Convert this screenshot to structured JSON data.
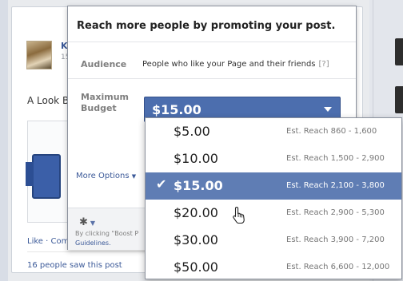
{
  "post": {
    "name": "Ke",
    "sub": "15",
    "text": "A Look B",
    "actions": "Like · Com",
    "saw": "16 people saw this post"
  },
  "boost": {
    "title": "Reach more people by promoting your post.",
    "audience_label": "Audience",
    "audience_value": "People who like your Page and their friends",
    "audience_help": "[?]",
    "budget_label": "Maximum Budget",
    "budget_selected": "$15.00",
    "more_options": "More Options",
    "footer_note": "By clicking \"Boost P",
    "footer_link": "Guidelines."
  },
  "dropdown": {
    "options": [
      {
        "price": "$5.00",
        "reach": "Est. Reach 860 - 1,600",
        "selected": false
      },
      {
        "price": "$10.00",
        "reach": "Est. Reach 1,500 - 2,900",
        "selected": false
      },
      {
        "price": "$15.00",
        "reach": "Est. Reach 2,100 - 3,800",
        "selected": true
      },
      {
        "price": "$20.00",
        "reach": "Est. Reach 2,900 - 5,300",
        "selected": false
      },
      {
        "price": "$30.00",
        "reach": "Est. Reach 3,900 - 7,200",
        "selected": false
      },
      {
        "price": "$50.00",
        "reach": "Est. Reach 6,600 - 12,000",
        "selected": false
      }
    ]
  },
  "colors": {
    "accent": "#4c6eae",
    "selected_row": "#5f7db4",
    "link": "#3b5998"
  },
  "icons": {
    "check": "check-icon",
    "gear": "gear-icon",
    "caret": "caret-down-icon",
    "cursor": "hand-pointer-icon"
  }
}
